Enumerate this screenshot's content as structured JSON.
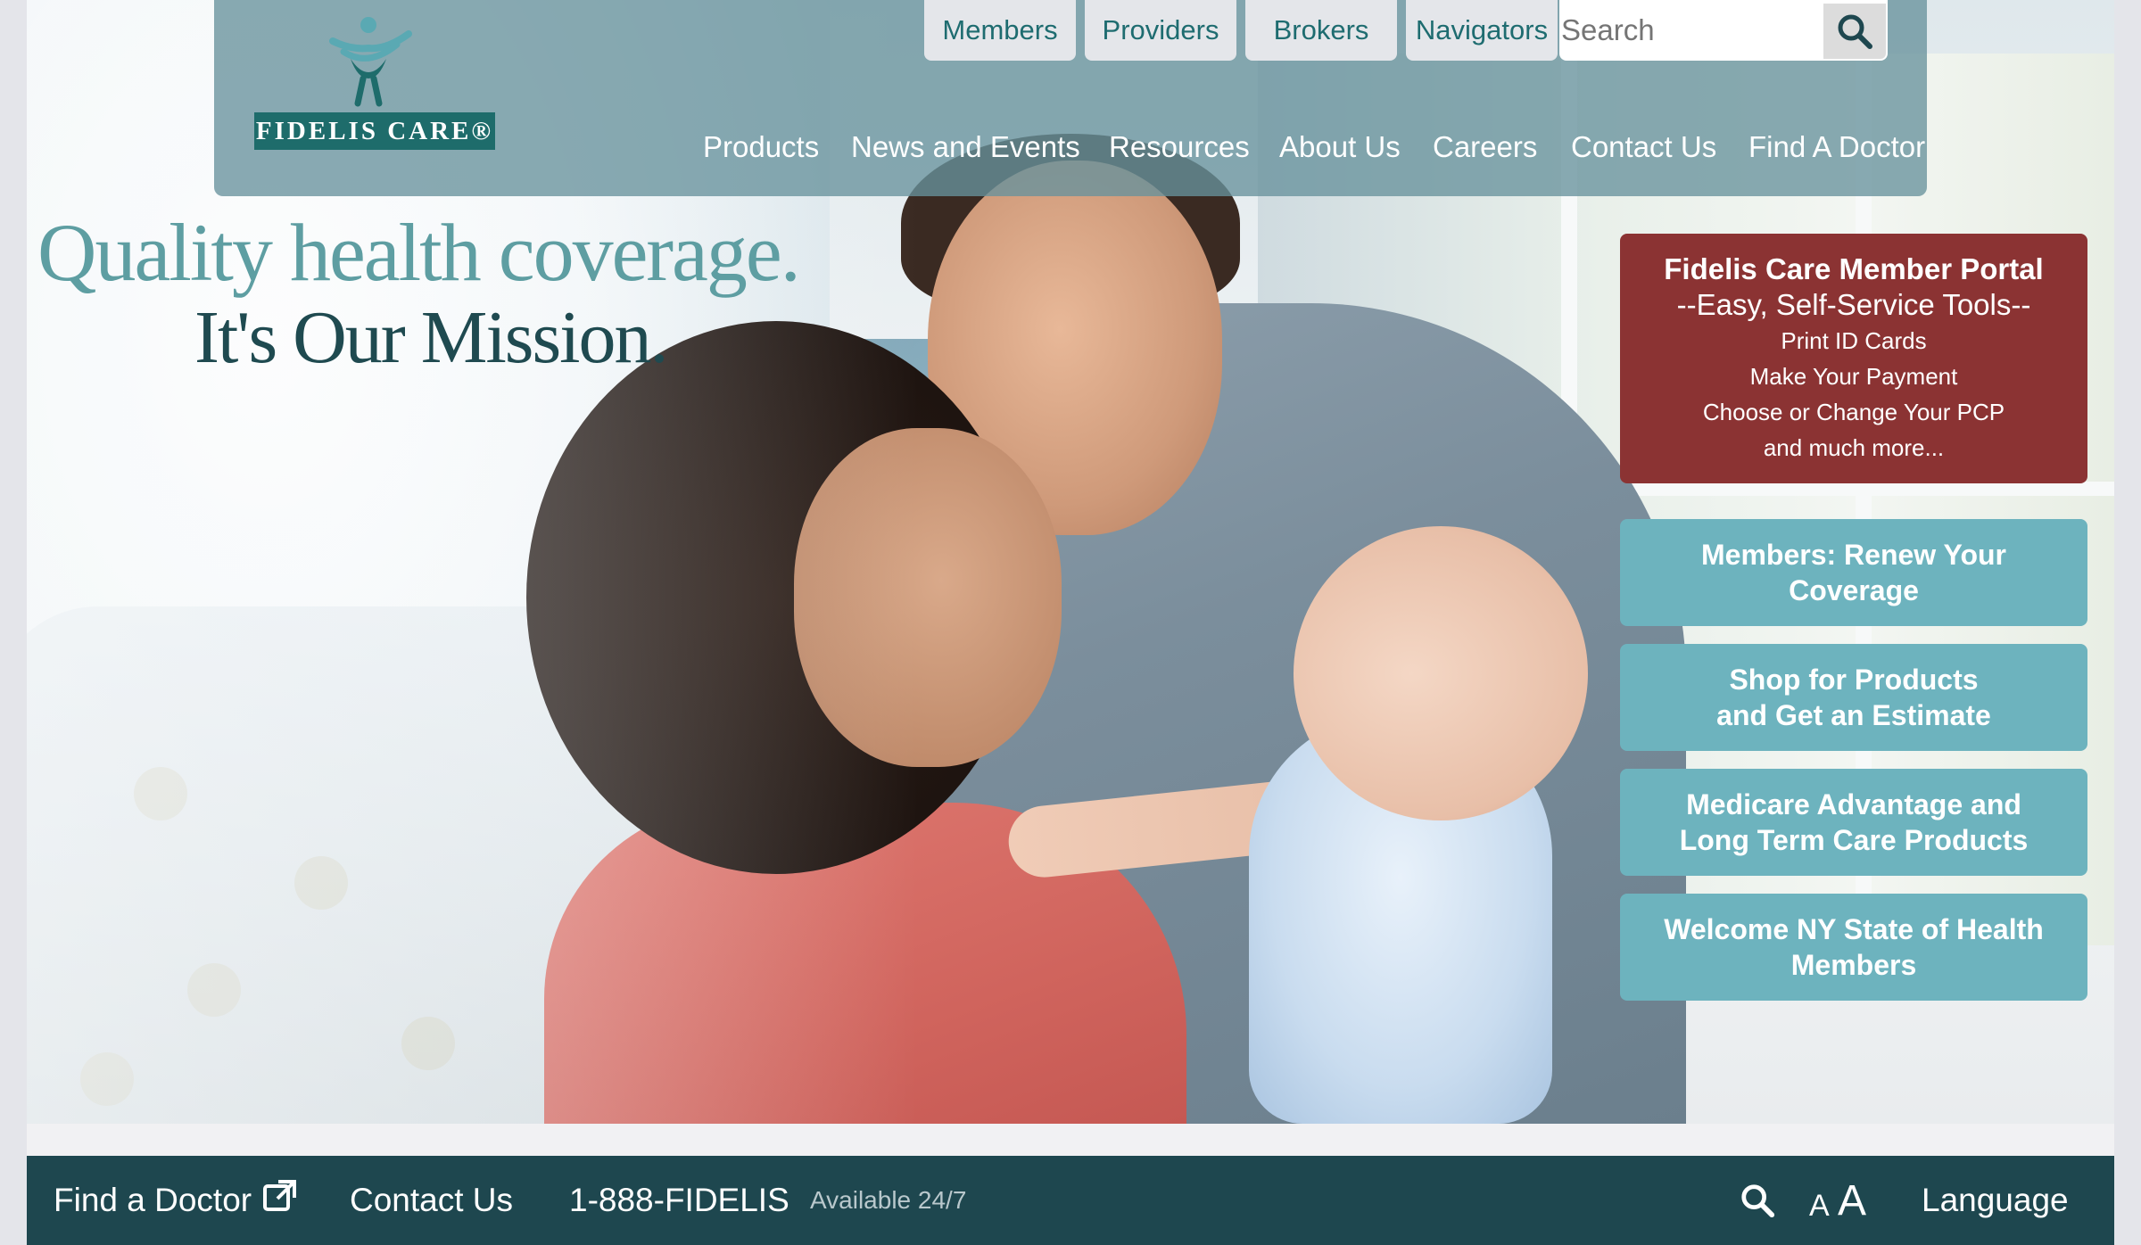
{
  "brand": {
    "logo_text": "FIDELIS CARE®",
    "colors": {
      "teal": "#1e6c6b",
      "header": "#68929c",
      "red": "#8b3333",
      "blue": "#6db3be",
      "footer": "#1e474f"
    }
  },
  "top_tabs": [
    "Members",
    "Providers",
    "Brokers",
    "Navigators"
  ],
  "search": {
    "placeholder": "Search",
    "icon": "search-icon"
  },
  "main_nav": [
    "Products",
    "News and Events",
    "Resources",
    "About Us",
    "Careers",
    "Contact Us",
    "Find A Doctor"
  ],
  "hero": {
    "tagline_line1": "Quality health coverage.",
    "tagline_line2": "It's Our Mission."
  },
  "portal": {
    "title": "Fidelis Care Member Portal",
    "subtitle": "--Easy, Self-Service Tools--",
    "items": [
      "Print ID Cards",
      "Make Your Payment",
      "Choose or Change Your PCP",
      "and much more..."
    ]
  },
  "cta_buttons": [
    {
      "line1": "Members: Renew Your",
      "line2": "Coverage"
    },
    {
      "line1": "Shop for Products",
      "line2": "and Get an Estimate"
    },
    {
      "line1": "Medicare Advantage and",
      "line2": "Long Term Care Products"
    },
    {
      "line1": "Welcome NY State of Health",
      "line2": "Members"
    }
  ],
  "footer": {
    "find_doctor": "Find a Doctor",
    "find_doctor_icon": "external-link-icon",
    "contact": "Contact Us",
    "phone": "1-888-FIDELIS",
    "availability": "Available 24/7",
    "text_size_small": "A",
    "text_size_large": "A",
    "language": "Language"
  }
}
